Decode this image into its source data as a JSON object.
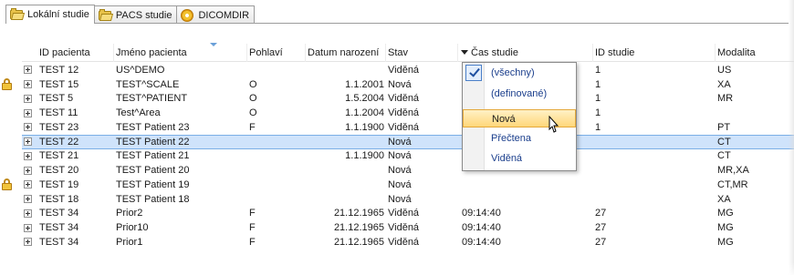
{
  "tabs": [
    {
      "label": "Lokální studie",
      "icon": "folder-icon",
      "active": true
    },
    {
      "label": "PACS studie",
      "icon": "folder-icon",
      "active": false
    },
    {
      "label": "DICOMDIR",
      "icon": "disc-icon",
      "active": false
    }
  ],
  "columns": [
    "ID pacienta",
    "Jméno pacienta",
    "Pohlaví",
    "Datum narození",
    "Stav",
    "Čas studie",
    "ID studie",
    "Modalita"
  ],
  "rows": [
    {
      "id": "TEST 12",
      "name": "US^DEMO",
      "sex": "",
      "dob": "",
      "state": "Viděná",
      "time": "",
      "study": "1",
      "mod": "US",
      "locked": false,
      "selected": false
    },
    {
      "id": "TEST 15",
      "name": "TEST^SCALE",
      "sex": "O",
      "dob": "1.1.2001",
      "state": "Nová",
      "time": "",
      "study": "1",
      "mod": "XA",
      "locked": true,
      "selected": false
    },
    {
      "id": "TEST 5",
      "name": "TEST^PATIENT",
      "sex": "O",
      "dob": "1.5.2004",
      "state": "Viděná",
      "time": "",
      "study": "1",
      "mod": "MR",
      "locked": false,
      "selected": false
    },
    {
      "id": "TEST 11",
      "name": "Test^Area",
      "sex": "O",
      "dob": "1.1.2004",
      "state": "Viděná",
      "time": "",
      "study": "1",
      "mod": "",
      "locked": false,
      "selected": false
    },
    {
      "id": "TEST 23",
      "name": "TEST Patient 23",
      "sex": "F",
      "dob": "1.1.1900",
      "state": "Viděná",
      "time": "",
      "study": "1",
      "mod": "PT",
      "locked": false,
      "selected": false
    },
    {
      "id": "TEST 22",
      "name": "TEST Patient 22",
      "sex": "",
      "dob": "",
      "state": "Nová",
      "time": "",
      "study": "",
      "mod": "CT",
      "locked": false,
      "selected": true
    },
    {
      "id": "TEST 21",
      "name": "TEST Patient 21",
      "sex": "",
      "dob": "1.1.1900",
      "state": "Nová",
      "time": "",
      "study": "",
      "mod": "CT",
      "locked": false,
      "selected": false
    },
    {
      "id": "TEST 20",
      "name": "TEST Patient 20",
      "sex": "",
      "dob": "",
      "state": "Nová",
      "time": "",
      "study": "",
      "mod": "MR,XA",
      "locked": false,
      "selected": false
    },
    {
      "id": "TEST 19",
      "name": "TEST Patient 19",
      "sex": "",
      "dob": "",
      "state": "Nová",
      "time": "",
      "study": "",
      "mod": "CT,MR",
      "locked": true,
      "selected": false
    },
    {
      "id": "TEST 18",
      "name": "TEST Patient 18",
      "sex": "",
      "dob": "",
      "state": "Nová",
      "time": "",
      "study": "",
      "mod": "XA",
      "locked": false,
      "selected": false
    },
    {
      "id": "TEST 34",
      "name": "Prior2",
      "sex": "F",
      "dob": "21.12.1965",
      "state": "Viděná",
      "time": "09:14:40",
      "study": "27",
      "mod": "MG",
      "locked": false,
      "selected": false
    },
    {
      "id": "TEST 34",
      "name": "Prior10",
      "sex": "F",
      "dob": "21.12.1965",
      "state": "Viděná",
      "time": "09:14:40",
      "study": "27",
      "mod": "MG",
      "locked": false,
      "selected": false
    },
    {
      "id": "TEST 34",
      "name": "Prior1",
      "sex": "F",
      "dob": "21.12.1965",
      "state": "Viděná",
      "time": "09:14:40",
      "study": "27",
      "mod": "MG",
      "locked": false,
      "selected": false
    }
  ],
  "filter_menu": {
    "items": [
      "(všechny)",
      "(definované)",
      "Nová",
      "Přečtena",
      "Viděná"
    ],
    "checked_index": 0,
    "hover_index": 2
  },
  "colors": {
    "selected_row": "#cfe3fb",
    "menu_text": "#1a3e8c",
    "menu_hover": "#ffd77a"
  }
}
